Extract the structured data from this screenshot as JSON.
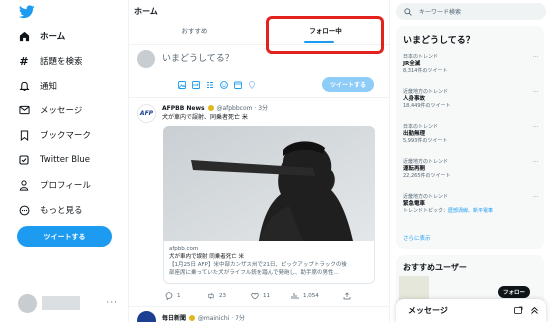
{
  "nav": {
    "items": [
      {
        "label": "ホーム",
        "icon": "home-icon"
      },
      {
        "label": "話題を検索",
        "icon": "hashtag-icon"
      },
      {
        "label": "通知",
        "icon": "bell-icon"
      },
      {
        "label": "メッセージ",
        "icon": "mail-icon"
      },
      {
        "label": "ブックマーク",
        "icon": "bookmark-icon"
      },
      {
        "label": "Twitter Blue",
        "icon": "twitter-blue-icon"
      },
      {
        "label": "プロフィール",
        "icon": "person-icon"
      },
      {
        "label": "もっと見る",
        "icon": "more-circle-icon"
      }
    ],
    "tweet_button": "ツイートする",
    "account_more": "···"
  },
  "timeline": {
    "title": "ホーム",
    "tabs": [
      {
        "label": "おすすめ"
      },
      {
        "label": "フォロー中"
      }
    ],
    "compose_placeholder": "いまどうしてる？",
    "compose_button": "ツイートする",
    "tweet": {
      "author": "AFPBB News",
      "handle": "@afpbbcom",
      "time": "3分",
      "avatar_text": "AFP",
      "text": "犬が車内で誤射、同乗者死亡 米",
      "card": {
        "domain": "afpbb.com",
        "title": "犬が車内で誤射 同乗者死亡 米",
        "desc_line1": "【1月25日 AFP】米中部カンザス州で21日、ピックアップトラックの後",
        "desc_line2": "部座席に乗っていた犬がライフル銃を踏んで発砲し、助手席の男性..."
      },
      "replies": "1",
      "retweets": "23",
      "likes": "11",
      "views": "1,054"
    },
    "next_tweet": {
      "author": "毎日新聞",
      "handle": "@mainichi",
      "time": "7分"
    }
  },
  "sidebar": {
    "search_placeholder": "キーワード検索",
    "trends_title": "いまどうしてる？",
    "trends": [
      {
        "context": "日本のトレンド",
        "name": "JR全滅",
        "count": "8,314件のツイート"
      },
      {
        "context": "近畿地方のトレンド",
        "name": "人身事故",
        "count": "18,449件のツイート"
      },
      {
        "context": "日本のトレンド",
        "name": "出勤無理",
        "count": "5,993件のツイート"
      },
      {
        "context": "近畿地方のトレンド",
        "name": "運転再開",
        "count": "22,265件のツイート"
      },
      {
        "context": "近畿地方のトレンド",
        "name": "緊急電車",
        "count": "トレンドトピック：",
        "links": "歴部渦線、新平電車"
      }
    ],
    "trend_more": "···",
    "show_more": "さらに表示",
    "recs_title": "おすすめユーザー",
    "follow_button": "フォロー",
    "messages_label": "メッセージ"
  },
  "colors": {
    "accent": "#1d9bf0",
    "highlight": "#e3211d",
    "text": "#0f1419",
    "muted": "#536471"
  }
}
